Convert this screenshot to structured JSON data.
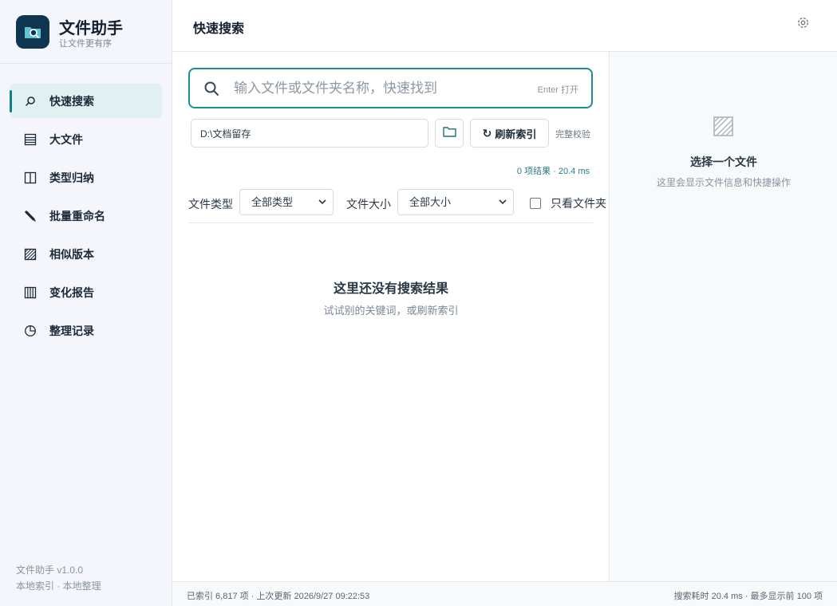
{
  "app": {
    "title": "文件助手",
    "subtitle": "让文件更有序",
    "version": "文件助手 v1.0.0",
    "footer_note": "本地索引 · 本地整理",
    "accent_color": "#11808a"
  },
  "sidebar": {
    "items": [
      {
        "label": "快速搜索",
        "icon": "search-icon",
        "active": true
      },
      {
        "label": "大文件",
        "icon": "list-icon",
        "active": false
      },
      {
        "label": "类型归纳",
        "icon": "columns-icon",
        "active": false
      },
      {
        "label": "批量重命名",
        "icon": "pencil-icon",
        "active": false
      },
      {
        "label": "相似版本",
        "icon": "hatch-icon",
        "active": false
      },
      {
        "label": "变化报告",
        "icon": "bars-icon",
        "active": false
      },
      {
        "label": "整理记录",
        "icon": "clock-pie-icon",
        "active": false
      }
    ]
  },
  "header": {
    "title": "快速搜索",
    "settings_icon": "gear-icon"
  },
  "search": {
    "placeholder": "输入文件或文件夹名称，快速找到",
    "value": "",
    "hint": "Enter 打开"
  },
  "path": {
    "value": "D:\\文档留存",
    "folder_icon": "folder-icon",
    "refresh_label": "刷新索引",
    "refresh_icon": "↻",
    "verify_label": "完整校验"
  },
  "results": {
    "stats": "0 项结果 · 20.4 ms",
    "empty_title": "这里还没有搜索结果",
    "empty_sub": "试试别的关键词，或刷新索引"
  },
  "filters": {
    "type_label": "文件类型",
    "type_value": "全部类型",
    "size_label": "文件大小",
    "size_value": "全部大小",
    "folders_only_label": "只看文件夹",
    "folders_only_checked": false
  },
  "detail": {
    "title": "选择一个文件",
    "sub": "这里会显示文件信息和快捷操作"
  },
  "status": {
    "left": "已索引 6,817 项 · 上次更新 2026/9/27 09:22:53",
    "right": "搜索耗时 20.4 ms · 最多显示前 100 项"
  }
}
